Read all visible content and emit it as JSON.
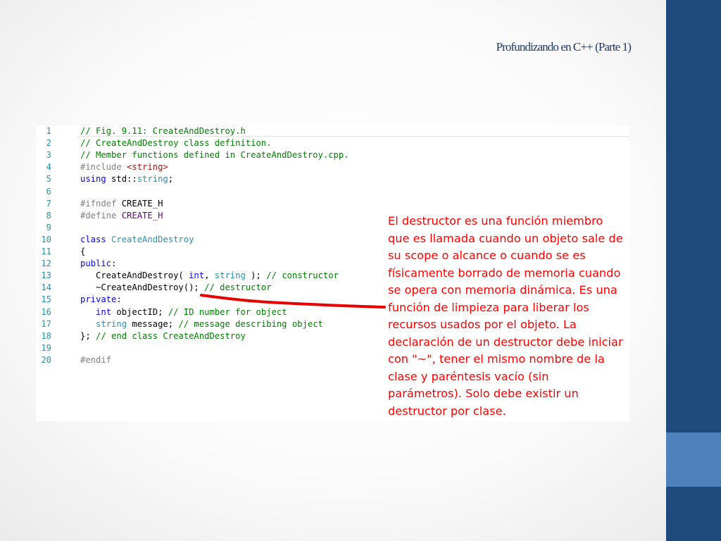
{
  "slide": {
    "title": "Profundizando en C++ (Parte 1)"
  },
  "colors": {
    "sidebar": "#1f4b7c",
    "sidebar_accent": "#4f81bd",
    "annotation": "#ff0000",
    "comment": "#008000",
    "keyword": "#0000ff",
    "type": "#2b91af",
    "preprocessor": "#808080",
    "macro": "#6f008a",
    "string_literal": "#a31515"
  },
  "code": {
    "lines": [
      {
        "n": "1",
        "tokens": [
          {
            "t": "// Fig. 9.11: CreateAndDestroy.h",
            "c": "c"
          }
        ]
      },
      {
        "n": "2",
        "tokens": [
          {
            "t": "// CreateAndDestroy class definition.",
            "c": "c"
          }
        ]
      },
      {
        "n": "3",
        "tokens": [
          {
            "t": "// Member functions defined in CreateAndDestroy.cpp.",
            "c": "c"
          }
        ]
      },
      {
        "n": "4",
        "tokens": [
          {
            "t": "#include ",
            "c": "p"
          },
          {
            "t": "<string>",
            "c": "s"
          }
        ]
      },
      {
        "n": "5",
        "tokens": [
          {
            "t": "using",
            "c": "k"
          },
          {
            "t": " std::",
            "c": "n"
          },
          {
            "t": "string",
            "c": "t"
          },
          {
            "t": ";",
            "c": "n"
          }
        ]
      },
      {
        "n": "6",
        "tokens": []
      },
      {
        "n": "7",
        "tokens": [
          {
            "t": "#ifndef ",
            "c": "p"
          },
          {
            "t": "CREATE_H",
            "c": "n"
          }
        ]
      },
      {
        "n": "8",
        "tokens": [
          {
            "t": "#define ",
            "c": "p"
          },
          {
            "t": "CREATE_H",
            "c": "m"
          }
        ]
      },
      {
        "n": "9",
        "tokens": []
      },
      {
        "n": "10",
        "tokens": [
          {
            "t": "class",
            "c": "k"
          },
          {
            "t": " ",
            "c": "n"
          },
          {
            "t": "CreateAndDestroy",
            "c": "t"
          }
        ]
      },
      {
        "n": "11",
        "tokens": [
          {
            "t": "{",
            "c": "n"
          }
        ]
      },
      {
        "n": "12",
        "tokens": [
          {
            "t": "public",
            "c": "k"
          },
          {
            "t": ":",
            "c": "n"
          }
        ]
      },
      {
        "n": "13",
        "tokens": [
          {
            "t": "   CreateAndDestroy( ",
            "c": "n"
          },
          {
            "t": "int",
            "c": "k"
          },
          {
            "t": ", ",
            "c": "n"
          },
          {
            "t": "string",
            "c": "t"
          },
          {
            "t": " ); ",
            "c": "n"
          },
          {
            "t": "// constructor",
            "c": "c"
          }
        ]
      },
      {
        "n": "14",
        "tokens": [
          {
            "t": "   ~CreateAndDestroy(); ",
            "c": "n"
          },
          {
            "t": "// destructor",
            "c": "c"
          }
        ]
      },
      {
        "n": "15",
        "tokens": [
          {
            "t": "private",
            "c": "k"
          },
          {
            "t": ":",
            "c": "n"
          }
        ]
      },
      {
        "n": "16",
        "tokens": [
          {
            "t": "   ",
            "c": "n"
          },
          {
            "t": "int",
            "c": "k"
          },
          {
            "t": " objectID; ",
            "c": "n"
          },
          {
            "t": "// ID number for object",
            "c": "c"
          }
        ]
      },
      {
        "n": "17",
        "tokens": [
          {
            "t": "   ",
            "c": "n"
          },
          {
            "t": "string",
            "c": "t"
          },
          {
            "t": " message; ",
            "c": "n"
          },
          {
            "t": "// message describing object",
            "c": "c"
          }
        ]
      },
      {
        "n": "18",
        "tokens": [
          {
            "t": "}; ",
            "c": "n"
          },
          {
            "t": "// end class CreateAndDestroy",
            "c": "c"
          }
        ]
      },
      {
        "n": "19",
        "tokens": []
      },
      {
        "n": "20",
        "tokens": [
          {
            "t": "#endif",
            "c": "p"
          }
        ]
      }
    ]
  },
  "annotation": {
    "lines": [
      "El destructor es una función miembro",
      "que es llamada cuando un objeto sale de",
      "su scope o alcance o cuando se es",
      "físicamente borrado de memoria cuando",
      "se opera con memoria dinámica. Es una",
      "función de limpieza para liberar los",
      "recursos usados por el objeto. La",
      "declaración de un destructor debe iniciar",
      "con \"~\", tener el mismo nombre de la",
      "clase y paréntesis vacío (sin",
      "parámetros). Solo debe existir un",
      "destructor por clase."
    ]
  }
}
